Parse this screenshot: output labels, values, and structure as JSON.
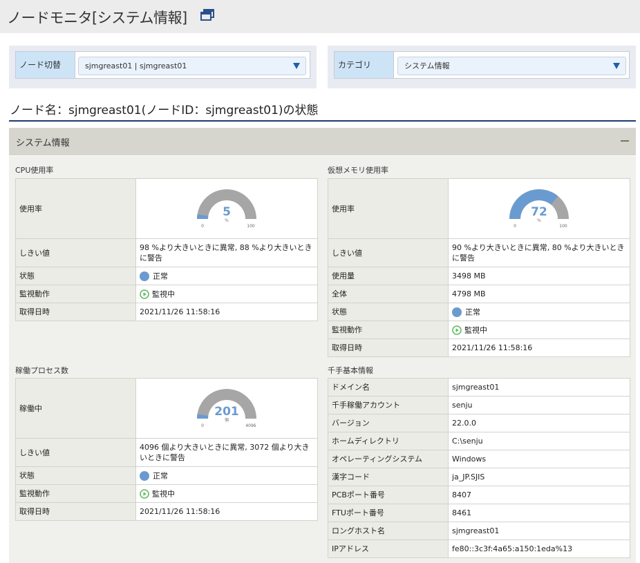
{
  "page": {
    "title": "ノードモニタ[システム情報]"
  },
  "selectors": {
    "node_label": "ノード切替",
    "node_value": "sjmgreast01 | sjmgreast01",
    "category_label": "カテゴリ",
    "category_value": "システム情報"
  },
  "node_heading": "ノード名：sjmgreast01(ノードID：sjmgreast01)の状態",
  "section": {
    "title": "システム情報"
  },
  "colors": {
    "gauge_fill": "#6a9bd0",
    "gauge_track": "#a6a6a6",
    "gauge_value_text": "#6a9bd0",
    "status_normal": "#6a9bd0",
    "monitoring_green": "#5cb85c"
  },
  "cpu": {
    "title": "CPU使用率",
    "gauge_label": "使用率",
    "gauge": {
      "value": 5,
      "display": "5",
      "unit": "%",
      "min": 0,
      "max": 100,
      "min_label": "0",
      "max_label": "100"
    },
    "rows": {
      "threshold_label": "しきい値",
      "threshold_value": "98 %より大きいときに異常, 88 %より大きいときに警告",
      "status_label": "状態",
      "status_value": "正常",
      "monitor_label": "監視動作",
      "monitor_value": "監視中",
      "time_label": "取得日時",
      "time_value": "2021/11/26 11:58:16"
    }
  },
  "memory": {
    "title": "仮想メモリ使用率",
    "gauge_label": "使用率",
    "gauge": {
      "value": 72,
      "display": "72",
      "unit": "%",
      "min": 0,
      "max": 100,
      "min_label": "0",
      "max_label": "100"
    },
    "rows": {
      "threshold_label": "しきい値",
      "threshold_value": "90 %より大きいときに異常, 80 %より大きいときに警告",
      "used_label": "使用量",
      "used_value": "3498 MB",
      "total_label": "全体",
      "total_value": "4798 MB",
      "status_label": "状態",
      "status_value": "正常",
      "monitor_label": "監視動作",
      "monitor_value": "監視中",
      "time_label": "取得日時",
      "time_value": "2021/11/26 11:58:16"
    }
  },
  "process": {
    "title": "稼働プロセス数",
    "gauge_label": "稼働中",
    "gauge": {
      "value": 201,
      "display": "201",
      "unit": "個",
      "min": 0,
      "max": 4096,
      "min_label": "0",
      "max_label": "4096"
    },
    "rows": {
      "threshold_label": "しきい値",
      "threshold_value": "4096 個より大きいときに異常, 3072 個より大きいときに警告",
      "status_label": "状態",
      "status_value": "正常",
      "monitor_label": "監視動作",
      "monitor_value": "監視中",
      "time_label": "取得日時",
      "time_value": "2021/11/26 11:58:16"
    }
  },
  "senju": {
    "title": "千手基本情報",
    "rows": [
      {
        "label": "ドメイン名",
        "value": "sjmgreast01"
      },
      {
        "label": "千手稼働アカウント",
        "value": "senju"
      },
      {
        "label": "バージョン",
        "value": "22.0.0"
      },
      {
        "label": "ホームディレクトリ",
        "value": "C:\\senju"
      },
      {
        "label": "オペレーティングシステム",
        "value": "Windows"
      },
      {
        "label": "漢字コード",
        "value": "ja_JP.SJIS"
      },
      {
        "label": "PCBポート番号",
        "value": "8407"
      },
      {
        "label": "FTUポート番号",
        "value": "8461"
      },
      {
        "label": "ロングホスト名",
        "value": "sjmgreast01"
      },
      {
        "label": "IPアドレス",
        "value": "fe80::3c3f:4a65:a150:1eda%13"
      }
    ]
  }
}
